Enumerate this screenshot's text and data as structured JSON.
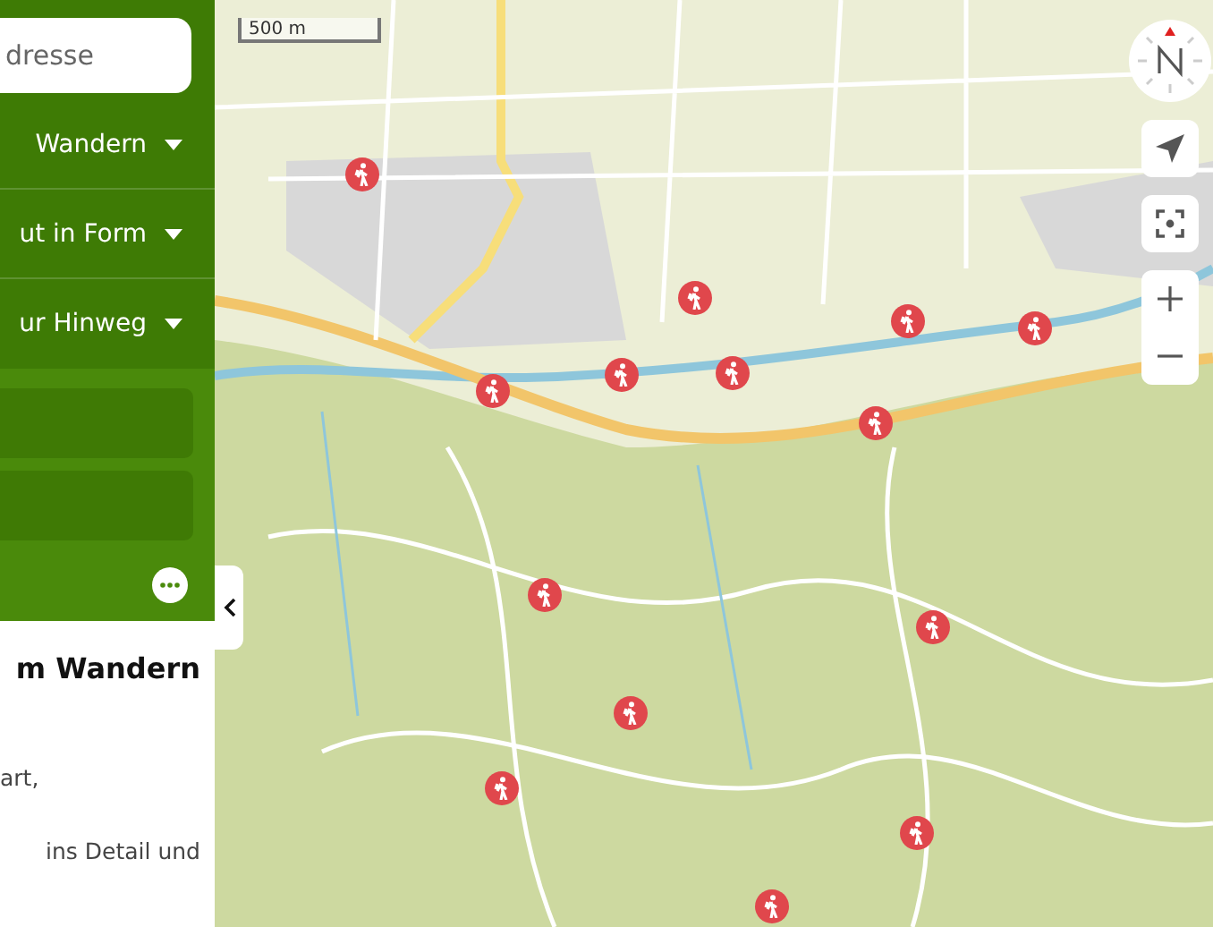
{
  "sidebar": {
    "search": {
      "placeholder": "dresse"
    },
    "filters": [
      {
        "label": "Wandern",
        "expanded": false
      },
      {
        "label": "ut in Form",
        "expanded": false
      },
      {
        "label": "ur Hinweg",
        "expanded": false
      }
    ],
    "panel": {
      "title": "m Wandern",
      "lines": [
        "art,",
        "ins Detail und"
      ]
    }
  },
  "map": {
    "scale": "500 m"
  }
}
